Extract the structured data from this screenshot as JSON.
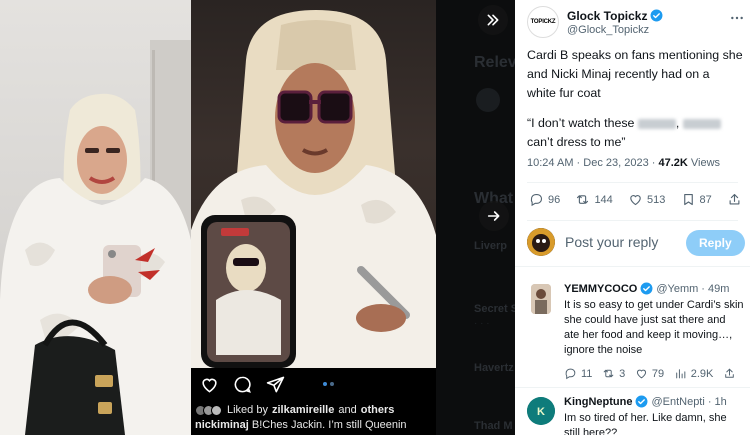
{
  "tweet": {
    "author_name": "Glock Topickz",
    "author_handle": "@Glock_Topickz",
    "avatar_label": "TOPICKZ",
    "text_line1": "Cardi B speaks on fans mentioning she",
    "text_line2": "and Nicki Minaj recently had on a",
    "text_line3": "white fur coat",
    "quote_open": "“I don’t watch these",
    "quote_mid": ",",
    "quote_end": "can’t dress to me”",
    "time": "10:24 AM · Dec 23, 2023 ·",
    "views_count": "47.2K",
    "views_label": "Views",
    "replies": "96",
    "reposts": "144",
    "likes": "513",
    "bookmarks": "87"
  },
  "compose": {
    "placeholder": "Post your reply",
    "button_label": "Reply"
  },
  "replies": [
    {
      "name": "YEMMYCOCO",
      "handle": "@Yemm",
      "time": "· 49m",
      "lines": [
        "It is so easy to get under Cardi’s skin",
        "she could have just sat there and",
        "ate her food and keep it moving…,",
        "ignore the noise"
      ],
      "replies": "11",
      "reposts": "3",
      "likes": "79",
      "views": "2.9K"
    },
    {
      "name": "KingNeptune",
      "handle": "@EntNepti",
      "time": "· 1h",
      "lines": [
        "Im so tired of her. Like damn, she",
        "still here??"
      ]
    }
  ],
  "instagram": {
    "liked_prefix": "Liked by",
    "liked_user": "zilkamireille",
    "liked_and": "and",
    "liked_others": "others",
    "caption_user": "nickiminaj",
    "caption_text": "B!Ches Jackin. I’m still Queenin"
  },
  "background_page": {
    "relevant": "Relev",
    "whats": "What",
    "trend1": "Liverp",
    "trend2": "Secret S",
    "trend3": "Havertz",
    "trend4": "Thad M"
  },
  "colors": {
    "accent": "#1d9bf0",
    "reply_button": "#8ecdf8",
    "verified": "#1d9bf0",
    "text_primary": "#0f1419",
    "text_secondary": "#536471"
  }
}
